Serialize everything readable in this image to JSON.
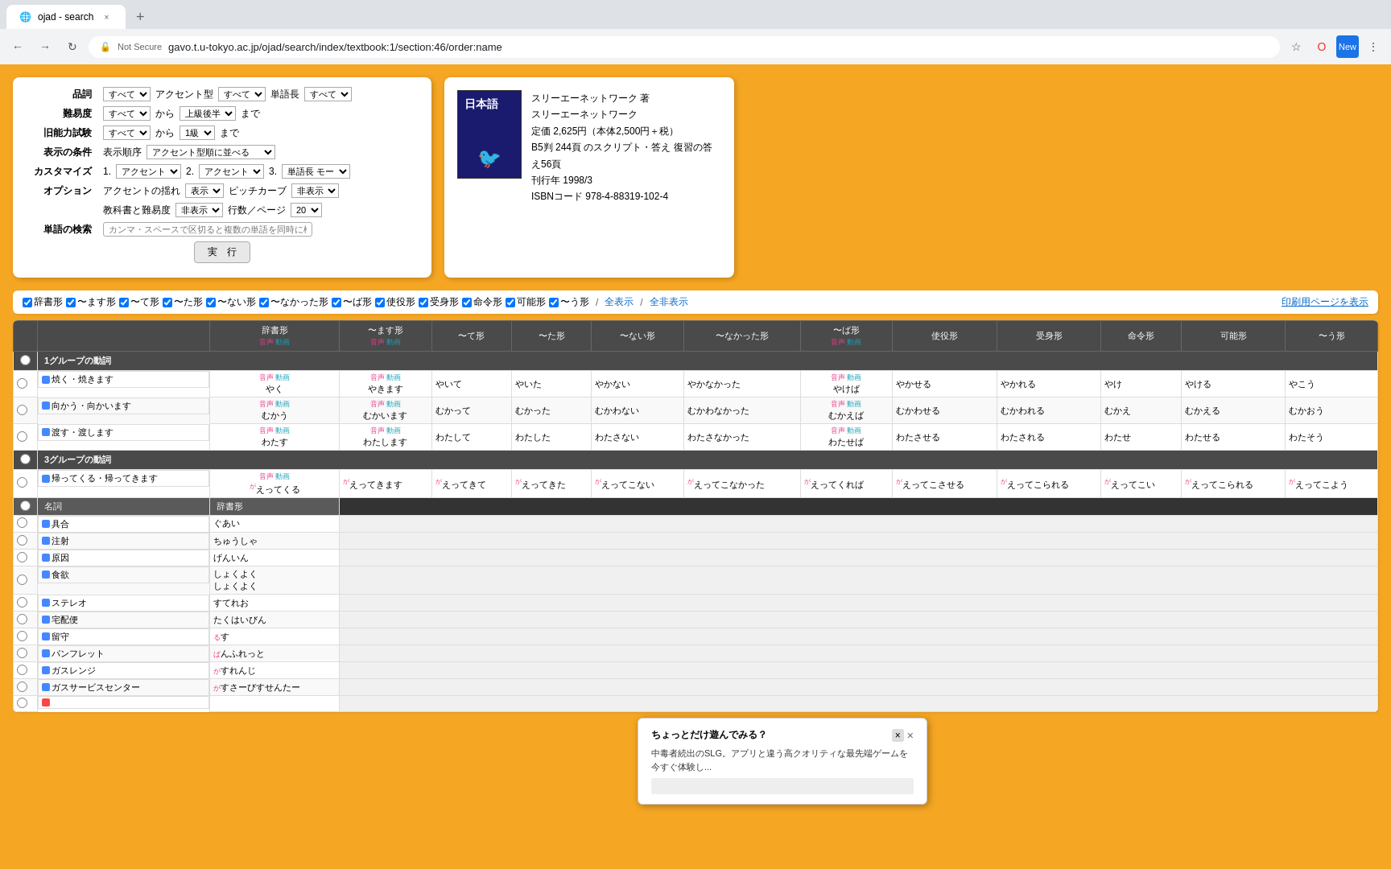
{
  "browser": {
    "tab_title": "ojad - search",
    "tab_close": "×",
    "new_tab": "+",
    "nav": {
      "back": "←",
      "forward": "→",
      "refresh": "↻",
      "home": "⌂"
    },
    "address": "gavo.t.u-tokyo.ac.jp/ojad/search/index/textbook:1/section:46/order:name",
    "security_label": "Not Secure"
  },
  "search_form": {
    "rows": [
      {
        "label": "品詞",
        "fields": [
          {
            "type": "select",
            "value": "すべて",
            "options": [
              "すべて"
            ]
          },
          {
            "label": "アクセント型"
          },
          {
            "type": "select",
            "value": "すべて",
            "options": [
              "すべて"
            ]
          },
          {
            "label": "単語長"
          },
          {
            "type": "select",
            "value": "すべて",
            "options": [
              "すべて"
            ]
          }
        ]
      },
      {
        "label": "難易度",
        "fields": [
          {
            "type": "select",
            "value": "すべて",
            "options": [
              "すべて"
            ]
          },
          {
            "label": "から"
          },
          {
            "type": "select",
            "value": "上級後半",
            "options": [
              "上級後半"
            ]
          },
          {
            "label": "まで"
          }
        ]
      },
      {
        "label": "旧能力試験",
        "fields": [
          {
            "type": "select",
            "value": "すべて",
            "options": [
              "すべて"
            ]
          },
          {
            "label": "から"
          },
          {
            "type": "select",
            "value": "1級",
            "options": [
              "1級"
            ]
          },
          {
            "label": "まで"
          }
        ]
      },
      {
        "label": "表示の条件",
        "sublabel": "表示順序",
        "field_value": "アクセント型順に並べる"
      },
      {
        "label": "カスタマイズ",
        "items": [
          "1. アクセント",
          "2. アクセント",
          "3. 単語長 モー"
        ]
      },
      {
        "label": "オプション",
        "accent_label": "アクセントの揺れ",
        "accent_value": "表示",
        "pitch_label": "ピッチカーブ",
        "pitch_value": "非表示",
        "textbook_label": "教科書と難易度",
        "textbook_value": "非表示",
        "pages_label": "行数／ページ",
        "pages_value": "20"
      }
    ],
    "search_placeholder": "カンマ・スペースで区切ると複数の単語を同時に検索できます。",
    "submit_label": "実　行"
  },
  "book": {
    "title": "日本語",
    "author": "スリーエーネットワーク 著",
    "publisher": "スリーエーネットワーク",
    "price": "定価 2,625円（本体2,500円＋税）",
    "details": "B5判 244頁 のスクリプト・答え 復習の答え56頁",
    "year": "刊行年 1998/3",
    "isbn": "ISBNコード 978-4-88319-102-4"
  },
  "filters": [
    {
      "label": "辞書形",
      "checked": true
    },
    {
      "label": "〜ます形",
      "checked": true
    },
    {
      "label": "〜て形",
      "checked": true
    },
    {
      "label": "〜た形",
      "checked": true
    },
    {
      "label": "〜ない形",
      "checked": true
    },
    {
      "label": "〜なかった形",
      "checked": true
    },
    {
      "label": "〜ば形",
      "checked": true
    },
    {
      "label": "使役形",
      "checked": true
    },
    {
      "label": "受身形",
      "checked": true
    },
    {
      "label": "命令形",
      "checked": true
    },
    {
      "label": "可能形",
      "checked": true
    },
    {
      "label": "〜う形",
      "checked": true
    },
    {
      "label": "全表示",
      "checked": false
    },
    {
      "label": "全非表示",
      "checked": false
    }
  ],
  "print_label": "印刷用ページを表示",
  "table": {
    "group1_header": "1グループの動詞",
    "group3_header": "3グループの動詞",
    "noun_header": "名詞",
    "columns": [
      "辞書形",
      "〜ます形",
      "〜て形",
      "〜た形",
      "〜ない形",
      "〜なかった形",
      "〜ば形",
      "使役形",
      "受身形",
      "命令形",
      "可能形",
      "〜う形"
    ],
    "group1_rows": [
      {
        "name": "焼く・焼きます",
        "jisho": "やく",
        "masu": "やきます",
        "te": "やいて",
        "ta": "やいた",
        "nai": "やかない",
        "nakatta": "やかなかった",
        "ba": "やけば",
        "shieki": "やかせる",
        "ukemi": "やかれる",
        "meirei": "やけ",
        "kanou": "やける",
        "volitional": "やこう"
      },
      {
        "name": "向かう・向かいます",
        "jisho": "むかう",
        "masu": "むかいます",
        "te": "むかって",
        "ta": "むかった",
        "nai": "むかわない",
        "nakatta": "むかわなかった",
        "ba": "むかえば",
        "shieki": "むかわせる",
        "ukemi": "むかわれる",
        "meirei": "むかえ",
        "kanou": "むかえる",
        "volitional": "むかおう"
      },
      {
        "name": "渡す・渡します",
        "jisho": "わたす",
        "masu": "わたします",
        "te": "わたして",
        "ta": "わたした",
        "nai": "わたさない",
        "nakatta": "わたさなかった",
        "ba": "わたせば",
        "shieki": "わたさせる",
        "ukemi": "わたされる",
        "meirei": "わたせ",
        "kanou": "わたせる",
        "volitional": "わたそう"
      }
    ],
    "group3_rows": [
      {
        "name": "帰ってくる・帰ってきます",
        "jisho": "がえってくる",
        "masu": "がえってきます",
        "te": "がえってきて",
        "ta": "がえってきた",
        "nai": "がえってこない",
        "nakatta": "がえってこなかった",
        "ba": "がえってくれば",
        "shieki": "がえってこさせる",
        "ukemi": "がえってこられる",
        "meirei": "がえってこい",
        "kanou": "がえってこられる",
        "volitional": "がえってこよう"
      }
    ],
    "noun_rows": [
      {
        "name": "具合",
        "jisho": "ぐあい"
      },
      {
        "name": "注射",
        "jisho": "ちゅうしゃ"
      },
      {
        "name": "原因",
        "jisho": "げんいん"
      },
      {
        "name": "食欲",
        "jisho1": "しょくよく",
        "jisho2": "しょくよく"
      },
      {
        "name": "ステレオ",
        "jisho": "すてれお"
      },
      {
        "name": "宅配便",
        "jisho": "たくはいびん"
      },
      {
        "name": "留守",
        "jisho": "るす"
      },
      {
        "name": "パンフレット",
        "jisho": "ぱんふれっと"
      },
      {
        "name": "ガスレンジ",
        "jisho": "がすれんじ"
      },
      {
        "name": "ガスサービスセンター",
        "jisho": "がすさーびすせんたー"
      }
    ]
  },
  "ad": {
    "title": "ちょっとだけ遊んでみる？",
    "body": "中毒者続出のSLG。アプリと違う高クオリティな最先端ゲームを今すぐ体験し...",
    "close": "×",
    "dismiss": "✕"
  }
}
